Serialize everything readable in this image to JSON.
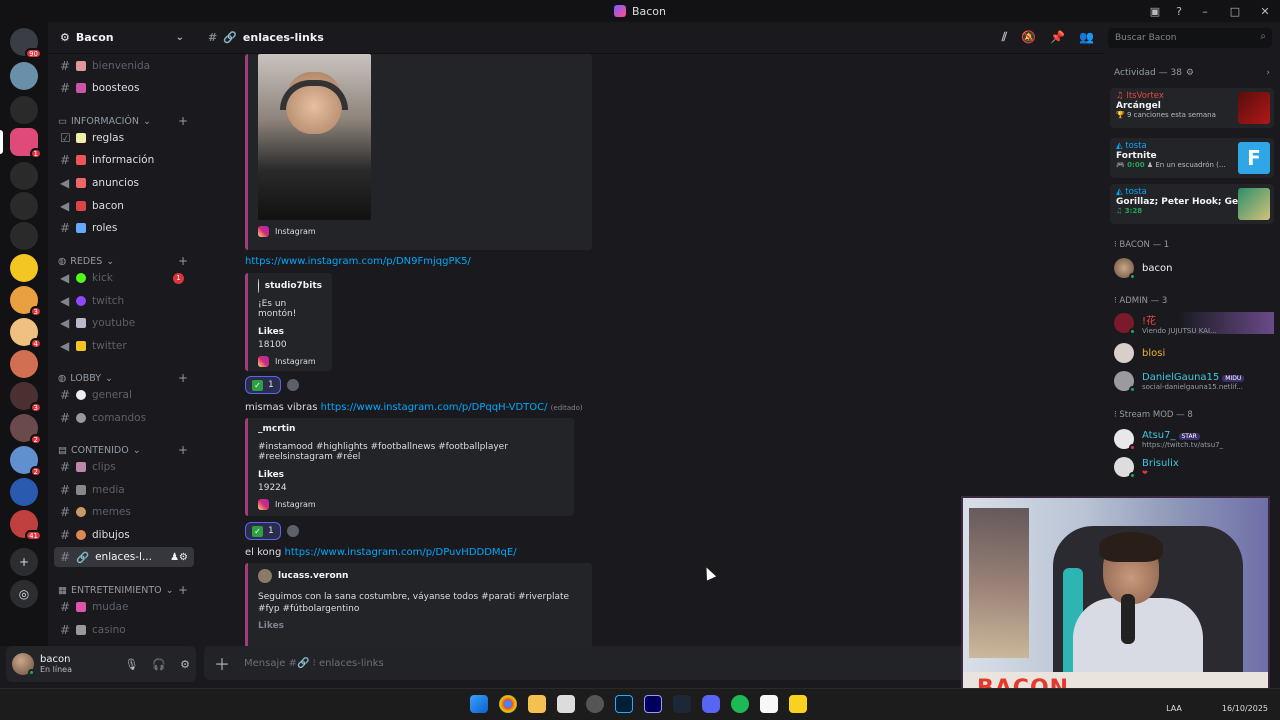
{
  "window": {
    "title": "Bacon"
  },
  "guild": {
    "name": "Bacon"
  },
  "rail_servers": [
    {
      "badge": "90"
    },
    {
      "badge": ""
    },
    {
      "badge": ""
    },
    {
      "badge": "1"
    },
    {
      "badge": ""
    },
    {
      "badge": ""
    },
    {
      "badge": ""
    },
    {
      "badge": ""
    },
    {
      "badge": "3"
    },
    {
      "badge": "4"
    },
    {
      "badge": ""
    },
    {
      "badge": "3"
    },
    {
      "badge": "2"
    },
    {
      "badge": "2"
    },
    {
      "badge": ""
    },
    {
      "badge": "41"
    }
  ],
  "channels": {
    "top": [
      {
        "name": "bienvenida"
      },
      {
        "name": "boosteos"
      }
    ],
    "cat_info": "INFORMACIÓN",
    "info": [
      {
        "name": "reglas"
      },
      {
        "name": "información"
      },
      {
        "name": "anuncios"
      },
      {
        "name": "bacon"
      },
      {
        "name": "roles"
      }
    ],
    "cat_redes": "REDES",
    "redes": [
      {
        "name": "kick",
        "badge": "1"
      },
      {
        "name": "twitch"
      },
      {
        "name": "youtube"
      },
      {
        "name": "twitter"
      }
    ],
    "cat_lobby": "LOBBY",
    "lobby": [
      {
        "name": "general"
      },
      {
        "name": "comandos"
      }
    ],
    "cat_contenido": "CONTENIDO",
    "contenido": [
      {
        "name": "clips"
      },
      {
        "name": "media"
      },
      {
        "name": "memes"
      },
      {
        "name": "dibujos"
      },
      {
        "name": "enlaces-l..."
      }
    ],
    "cat_entre": "ENTRETENIMIENTO",
    "entre": [
      {
        "name": "mudae"
      },
      {
        "name": "casino"
      }
    ]
  },
  "user": {
    "name": "bacon",
    "status": "En línea"
  },
  "chat": {
    "channel_name": "enlaces-links",
    "composer_placeholder": "Mensaje #🔗 ⁝ enlaces-links",
    "embed1_footer": "Instagram",
    "link1": "https://www.instagram.com/p/DN9FmjqgPK5/",
    "embed2": {
      "author": "studio7bits",
      "desc": "¡Es un montón!",
      "field_name": "Likes",
      "field_value": "18100",
      "footer": "Instagram"
    },
    "reaction1": {
      "count": "1"
    },
    "msg2_text": "mismas vibras ",
    "msg2_link": "https://www.instagram.com/p/DPqqH-VDTOC/",
    "msg2_edited": "(editado)",
    "embed3": {
      "author": "_mcrtin",
      "desc": "#instamood #highlights #footballnews #footballplayer #reelsinstagram #réel",
      "field_name": "Likes",
      "field_value": "19224",
      "footer": "Instagram"
    },
    "reaction2": {
      "count": "1"
    },
    "msg3_text": "el kong ",
    "msg3_link": "https://www.instagram.com/p/DPuvHDDDMqE/",
    "embed4": {
      "author": "lucass.veronn",
      "desc": "Seguimos con la sana costumbre, váyanse todos #parati #riverplate #fyp #fútbolargentino",
      "field_name": "Likes"
    }
  },
  "search": {
    "placeholder": "Buscar Bacon"
  },
  "activity": {
    "header": "Actividad — 38",
    "cards": [
      {
        "who": "ItsVortex",
        "what": "Arcángel",
        "detail": "9 canciones esta semana"
      },
      {
        "who": "tosta",
        "what": "Fortnite",
        "time": "0:00",
        "detail": "En un escuadrón (..."
      },
      {
        "who": "tosta",
        "what": "Gorillaz; Peter Hook; Geor...",
        "time": "3:28"
      }
    ]
  },
  "members": {
    "role_bacon": "BACON — 1",
    "bacon": "bacon",
    "role_admin": "ADMIN — 3",
    "admin1_name": "!花",
    "admin1_sub": "Viendo JUJUTSU KAI...",
    "admin2_name": "blosi",
    "admin3_name": "DanielGauna15",
    "admin3_tag": "MIDU",
    "admin3_sub": "social-danielgauna15.netlif...",
    "role_mod": "Stream MOD — 8",
    "mod1_name": "Atsu7_",
    "mod1_tag": "STAR",
    "mod1_sub": "https://twitch.tv/atsu7_",
    "mod2_name": "Brisulix",
    "mod2_sub": "❤"
  },
  "cam": {
    "banner": "BACON"
  },
  "taskbar": {
    "lang": "LAA",
    "date": "16/10/2025"
  },
  "colors": {
    "accent": "#5865f2",
    "link": "#00a8fc",
    "online": "#23a55a",
    "badge": "#da373c"
  }
}
